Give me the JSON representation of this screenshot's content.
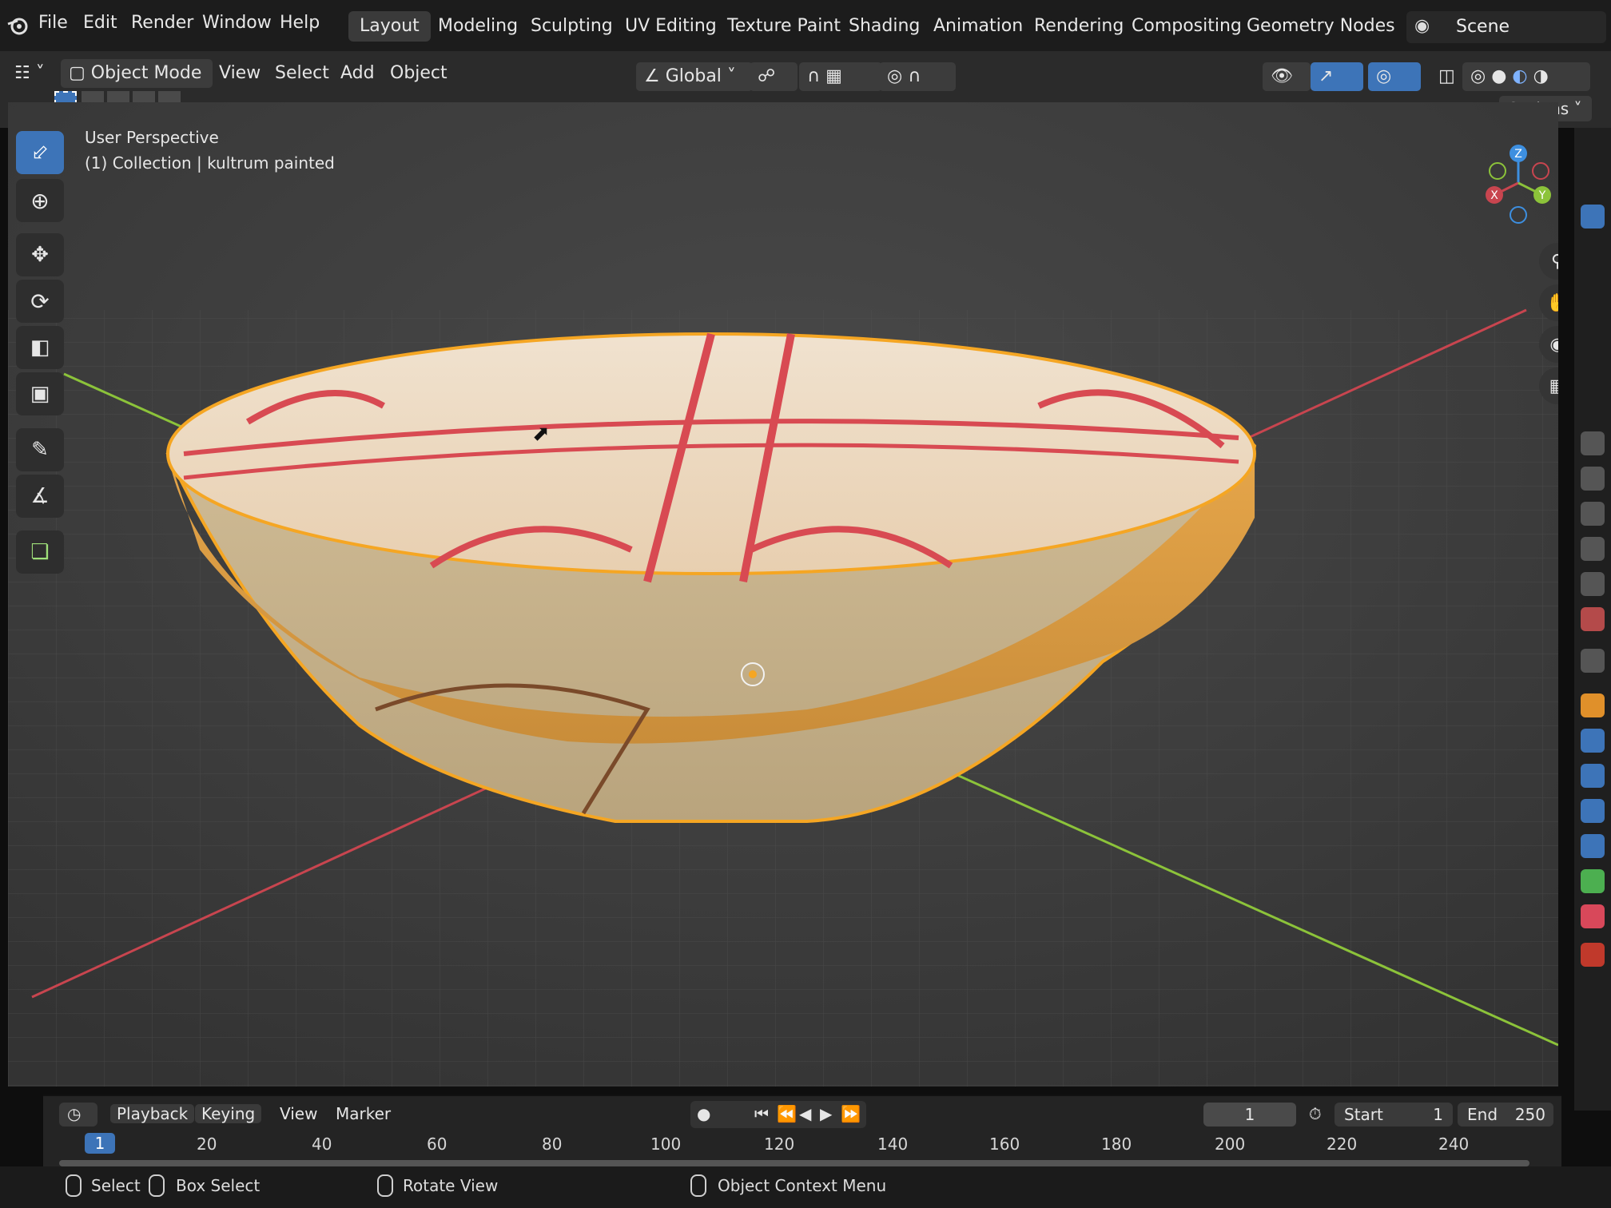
{
  "menu": {
    "items": [
      "File",
      "Edit",
      "Render",
      "Window",
      "Help"
    ]
  },
  "workspaces": [
    "Layout",
    "Modeling",
    "Sculpting",
    "UV Editing",
    "Texture Paint",
    "Shading",
    "Animation",
    "Rendering",
    "Compositing",
    "Geometry Nodes"
  ],
  "workspace_active": "Layout",
  "scene_label": "Scene",
  "header": {
    "mode": "Object Mode",
    "menus": [
      "View",
      "Select",
      "Add",
      "Object"
    ],
    "transform_orientation": "Global",
    "options_label": "Options"
  },
  "viewport": {
    "perspective_label": "User Perspective",
    "collection_label": "(1) Collection | kultrum painted"
  },
  "gizmo": {
    "z": "Z",
    "x": "X",
    "y": "Y"
  },
  "timeline": {
    "menus": [
      "Playback",
      "Keying",
      "View",
      "Marker"
    ],
    "current_frame": "1",
    "start_label": "Start",
    "start_value": "1",
    "end_label": "End",
    "end_value": "250",
    "ruler": [
      "20",
      "40",
      "60",
      "80",
      "100",
      "120",
      "140",
      "160",
      "180",
      "200",
      "220",
      "240"
    ],
    "playhead": "1"
  },
  "status": {
    "select": "Select",
    "box_select": "Box Select",
    "rotate_view": "Rotate View",
    "context_menu": "Object Context Menu"
  },
  "colors": {
    "selection_outline": "#f5a623",
    "x_axis": "#c8454f",
    "y_axis": "#8cc33a",
    "z_axis": "#3d8fe0",
    "active_tool": "#3d74b8"
  }
}
